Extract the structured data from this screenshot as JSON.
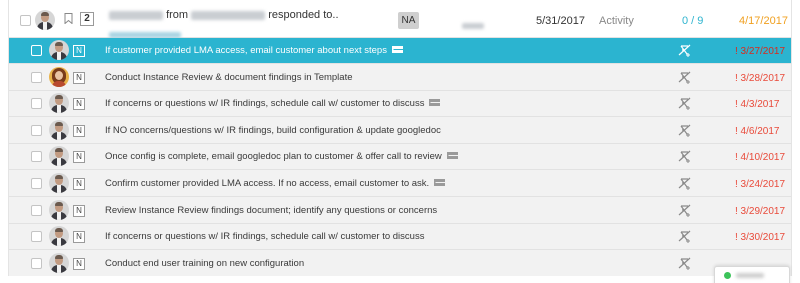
{
  "header_row": {
    "count": "2",
    "actor_from": "from",
    "actor_action": "responded to..",
    "status_badge": "NA",
    "date": "5/31/2017",
    "type": "Activity",
    "progress": "0 / 9",
    "due_date": "4/17/2017",
    "colors": {
      "progress": "#2eb4cf",
      "due": "#f0a020"
    },
    "icons": [
      "checkbox-icon",
      "avatar",
      "bookmark-icon"
    ]
  },
  "tasks": [
    {
      "text": "If customer provided LMA access, email customer about next steps",
      "email_icon": true,
      "badge": "N",
      "due": "! 3/27/2017",
      "selected": true,
      "avatar": "man"
    },
    {
      "text": "Conduct Instance Review & document findings in Template",
      "email_icon": false,
      "badge": "N",
      "due": "! 3/28/2017",
      "selected": false,
      "avatar": "woman"
    },
    {
      "text": "If concerns or questions w/ IR findings, schedule call w/ customer to discuss",
      "email_icon": true,
      "badge": "N",
      "due": "! 4/3/2017",
      "selected": false,
      "avatar": "man"
    },
    {
      "text": "If NO concerns/questions w/ IR findings, build configuration & update googledoc",
      "email_icon": false,
      "badge": "N",
      "due": "! 4/6/2017",
      "selected": false,
      "avatar": "man"
    },
    {
      "text": "Once config is complete, email googledoc plan to customer & offer call to review",
      "email_icon": true,
      "badge": "N",
      "due": "! 4/10/2017",
      "selected": false,
      "avatar": "man"
    },
    {
      "text": "Confirm customer provided LMA access. If no access, email customer to ask.",
      "email_icon": true,
      "badge": "N",
      "due": "! 3/24/2017",
      "selected": false,
      "avatar": "man"
    },
    {
      "text": "Review Instance Review findings document; identify any questions or concerns",
      "email_icon": false,
      "badge": "N",
      "due": "! 3/29/2017",
      "selected": false,
      "avatar": "man"
    },
    {
      "text": "If concerns or questions w/ IR findings, schedule call w/ customer to discuss",
      "email_icon": false,
      "badge": "N",
      "due": "! 3/30/2017",
      "selected": false,
      "avatar": "man"
    },
    {
      "text": "Conduct end user training on new configuration",
      "email_icon": false,
      "badge": "N",
      "due": "",
      "selected": false,
      "avatar": "man"
    }
  ],
  "row_icons": {
    "type_icon": "no-task-icon",
    "email": "envelope-icon"
  },
  "colors": {
    "selected_row": "#2bb4d0",
    "overdue": "#e94a3a",
    "row_bg": "#f2f2f2"
  }
}
